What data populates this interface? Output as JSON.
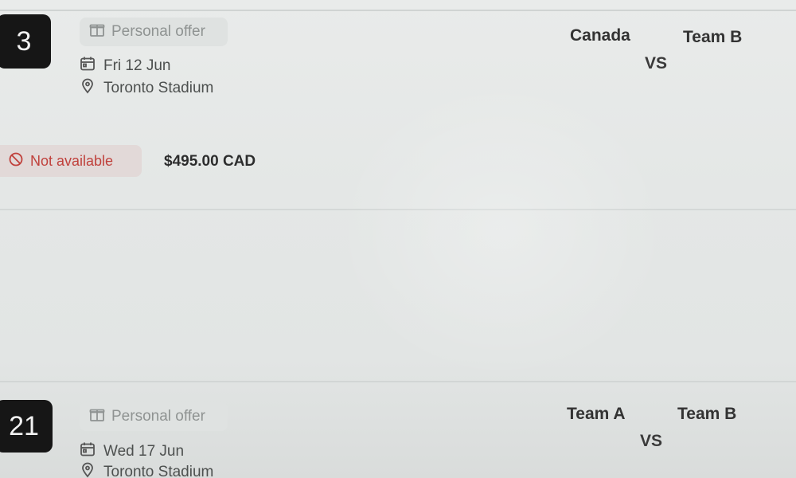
{
  "colors": {
    "number_badge_bg": "#161616",
    "unavailable_text": "#c0413c",
    "unavailable_bg": "#e2d9d8",
    "offer_text": "#8f9392"
  },
  "matches": [
    {
      "number": "3",
      "offer_label": "Personal offer",
      "offer_icon": "gift-icon",
      "date": "Fri 12 Jun",
      "date_icon": "calendar-icon",
      "venue": "Toronto Stadium",
      "venue_icon": "location-pin-icon",
      "team_home": "Canada",
      "vs_label": "VS",
      "team_away": "Team B",
      "availability": "Not available",
      "availability_icon": "no-entry-icon",
      "price": "$495.00 CAD"
    },
    {
      "number": "21",
      "offer_label": "Personal offer",
      "offer_icon": "gift-icon",
      "date": "Wed 17 Jun",
      "date_icon": "calendar-icon",
      "venue": "Toronto Stadium",
      "venue_icon": "location-pin-icon",
      "team_home": "Team A",
      "vs_label": "VS",
      "team_away": "Team B"
    }
  ]
}
